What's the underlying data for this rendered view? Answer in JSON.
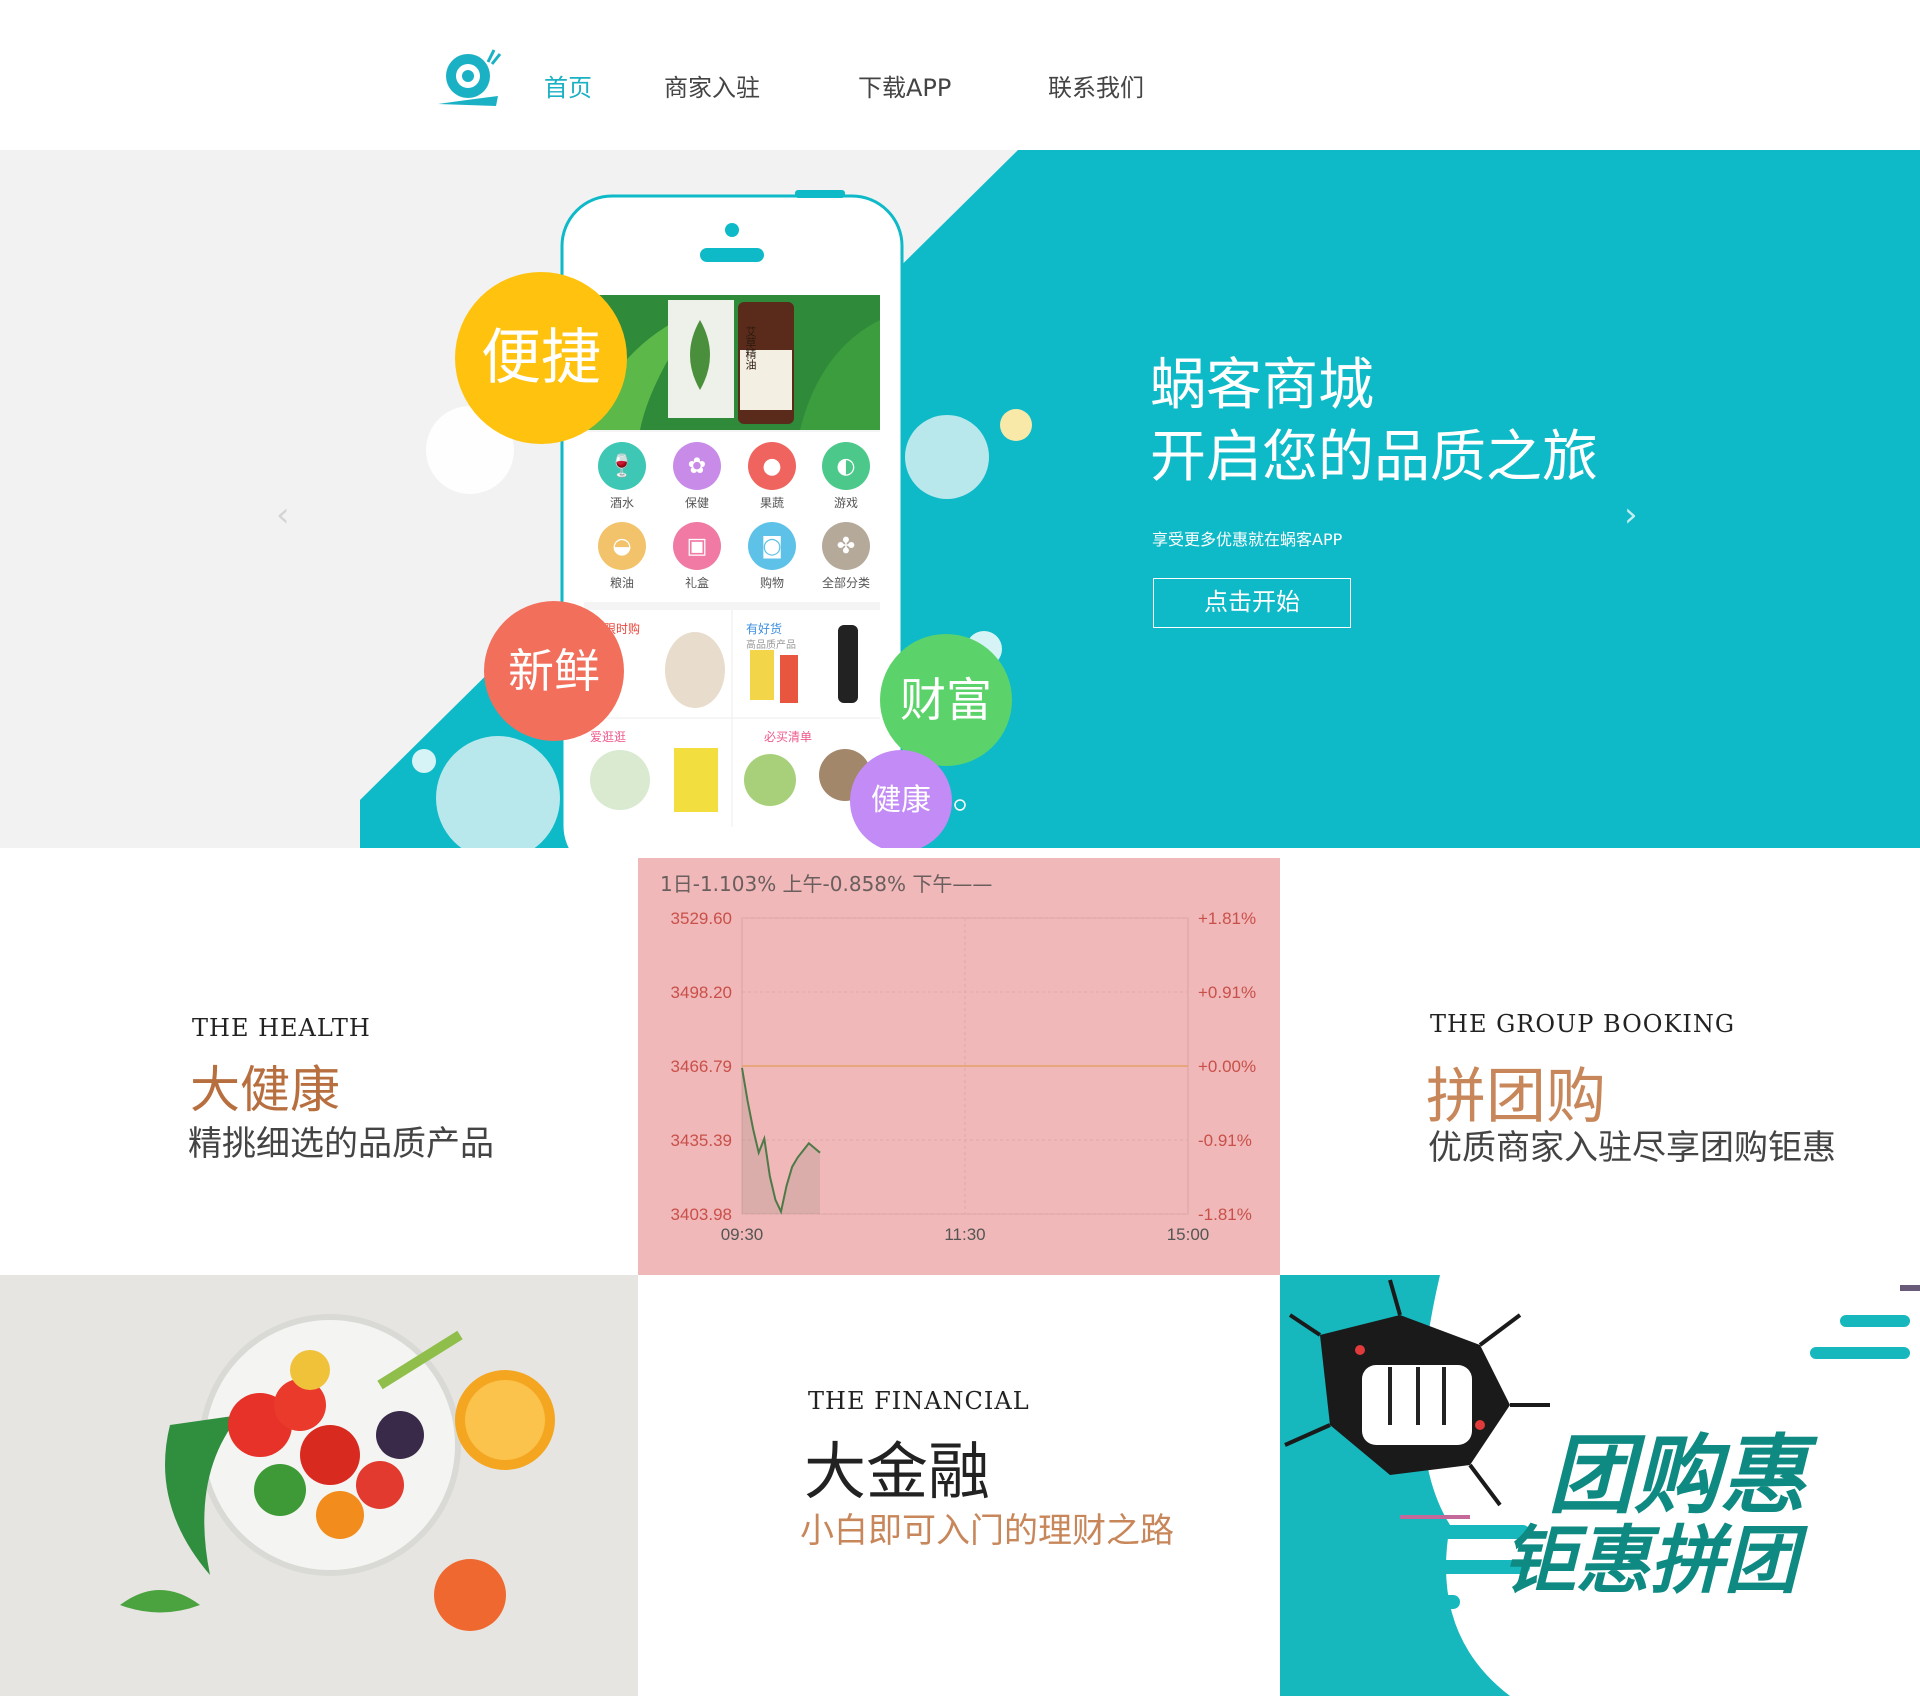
{
  "nav": {
    "items": [
      {
        "label": "首页",
        "active": true
      },
      {
        "label": "商家入驻",
        "active": false
      },
      {
        "label": "下载APP",
        "active": false
      },
      {
        "label": "联系我们",
        "active": false
      }
    ]
  },
  "hero": {
    "title": "蜗客商城\n开启您的品质之旅",
    "subtitle": "享受更多优惠就在蜗客APP",
    "cta": "点击开始",
    "bubbles": [
      "便捷",
      "新鲜",
      "财富",
      "健康"
    ],
    "phone": {
      "categories": [
        "酒水",
        "保健",
        "果蔬",
        "游戏",
        "粮油",
        "礼盒",
        "购物",
        "全部分类"
      ],
      "category_icons": [
        "bottle-icon",
        "flower-icon",
        "tomato-icon",
        "game-icon",
        "rice-bowl-icon",
        "gift-icon",
        "bag-icon",
        "grid-icon"
      ],
      "tags": [
        "限时购",
        "有好货",
        "爱逛逛",
        "必买清单"
      ],
      "tag_sub": "高品质产品",
      "product_label": "艾草精油"
    },
    "colors": {
      "teal": "#0fbac8",
      "yellow": "#ffc20e",
      "coral": "#f26f5c",
      "green": "#5bd36a",
      "purple": "#c28bf5"
    }
  },
  "health": {
    "en": "THE HEALTH",
    "cn": "大健康",
    "sub": "精挑细选的品质产品"
  },
  "group": {
    "en": "THE GROUP BOOKING",
    "cn": "拼团购",
    "sub": "优质商家入驻尽享团购钜惠"
  },
  "financial": {
    "en": "THE FINANCIAL",
    "cn": "大金融",
    "sub": "小白即可入门的理财之路"
  },
  "banner": {
    "line1": "团购惠",
    "line2": "钜惠拼团"
  },
  "chart_data": {
    "type": "line",
    "header": "1日-1.103%  上午-0.858%  下午——",
    "y_left_ticks": [
      "3529.60",
      "3498.20",
      "3466.79",
      "3435.39",
      "3403.98"
    ],
    "y_right_ticks": [
      "+1.81%",
      "+0.91%",
      "+0.00%",
      "-0.91%",
      "-1.81%"
    ],
    "x_ticks": [
      "09:30",
      "11:30",
      "15:00"
    ],
    "ylim": [
      3403.98,
      3529.6
    ],
    "baseline": 3466.79,
    "grid": true,
    "series": [
      {
        "values": [
          3466,
          3452,
          3440,
          3430,
          3436,
          3420,
          3410,
          3405,
          3416,
          3424,
          3428,
          3431,
          3434,
          3432,
          3430
        ]
      }
    ]
  }
}
